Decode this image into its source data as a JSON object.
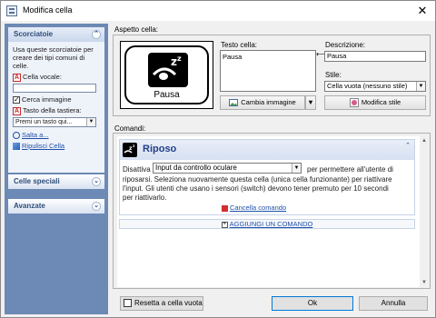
{
  "window": {
    "title": "Modifica cella"
  },
  "sidebar": {
    "shortcuts": {
      "header": "Scorciatoie",
      "description": "Usa queste scorciatoie per creare dei tipi comuni di celle.",
      "vocal_label": "Cella vocale:",
      "vocal_value": "",
      "search_image_label": "Cerca immagine",
      "search_image_checked": true,
      "keyboard_label": "Tasto della tastiera:",
      "keyboard_value": "Premi un tasto qui...",
      "jump_link": "Salta a...",
      "clean_link": "Ripulisci Cella"
    },
    "special_cells": {
      "header": "Celle speciali"
    },
    "advanced": {
      "header": "Avanzate"
    }
  },
  "appearance": {
    "section_label": "Aspetto cella:",
    "preview_label": "Pausa",
    "cell_text_label": "Testo cella:",
    "cell_text_value": "Pausa",
    "change_image_button": "Cambia immagine",
    "description_label": "Descrizione:",
    "description_value": "Pausa",
    "style_label": "Stile:",
    "style_value": "Cella vuota (nessuno stile)",
    "edit_style_button": "Modifica stile"
  },
  "commands": {
    "section_label": "Comandi:",
    "card": {
      "title": "Riposo",
      "line1_prefix": "Disattiva",
      "action_value": "Input da controllo oculare",
      "line1_suffix": "per permettere all'utente di",
      "line2": "riposarsi. Seleziona nuovamente questa cella (unica cella funzionante) per riattivare",
      "line3": "l'input. Gli utenti che usano i sensori (switch) devono tener premuto per 10 secondi",
      "line4": "per riattivarlo.",
      "cancel_link": "Cancella comando"
    },
    "add_command": "AGGIUNGI UN COMANDO"
  },
  "footer": {
    "reset_label": "Resetta a cella vuota",
    "ok_button": "Ok",
    "cancel_button": "Annulla"
  },
  "colors": {
    "sidebar_bg": "#6d89b5",
    "accent": "#23408a",
    "link": "#1f4fa8",
    "danger": "#d32f2f"
  }
}
